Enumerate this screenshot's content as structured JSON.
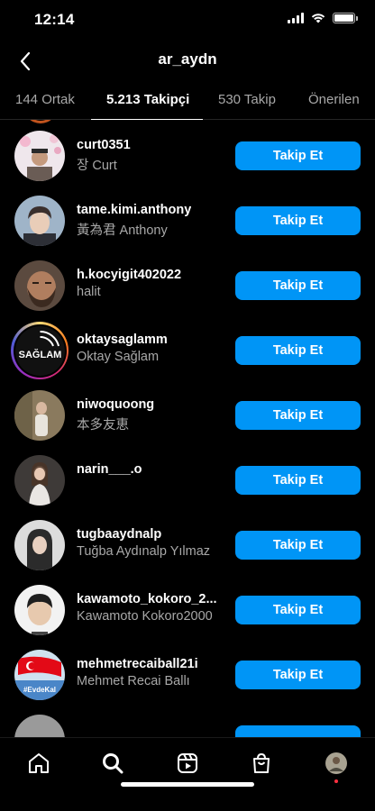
{
  "status_bar": {
    "time": "12:14"
  },
  "header": {
    "title": "ar_aydn"
  },
  "tabs": [
    {
      "label": "144 Ortak"
    },
    {
      "label": "5.213 Takipçi"
    },
    {
      "label": "530 Takip"
    },
    {
      "label": "Önerilen"
    }
  ],
  "follow_label": "Takip Et",
  "users": [
    {
      "username": "curt0351",
      "fullname": "장 Curt"
    },
    {
      "username": "tame.kimi.anthony",
      "fullname": "黃為君 Anthony"
    },
    {
      "username": "h.kocyigit402022",
      "fullname": "halit"
    },
    {
      "username": "oktaysaglamm",
      "fullname": "Oktay Sağlam",
      "avatar_text": "SAĞLAM"
    },
    {
      "username": "niwoquoong",
      "fullname": "本多友恵"
    },
    {
      "username": "narin___.o",
      "fullname": ""
    },
    {
      "username": "tugbaaydnalp",
      "fullname": "Tuğba Aydınalp Yılmaz"
    },
    {
      "username": "kawamoto_kokoro_2...",
      "fullname": "Kawamoto Kokoro2000"
    },
    {
      "username": "mehmetrecaiball21i",
      "fullname": "Mehmet Recai Ballı",
      "avatar_text": "#EvdeKal"
    }
  ],
  "colors": {
    "accent": "#0095f6",
    "background": "#000000",
    "secondary_text": "#a8a8a8"
  }
}
